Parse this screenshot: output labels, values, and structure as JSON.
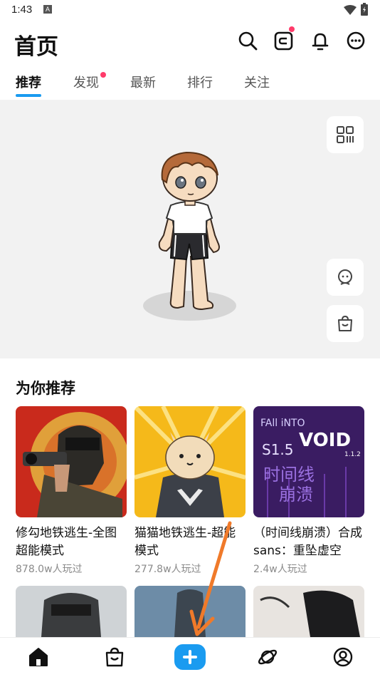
{
  "status_bar": {
    "time": "1:43",
    "notification_badge": "A"
  },
  "header": {
    "title": "首页"
  },
  "tabs": [
    {
      "label": "推荐",
      "active": true
    },
    {
      "label": "发现",
      "active": false,
      "dot": true
    },
    {
      "label": "最新",
      "active": false
    },
    {
      "label": "排行",
      "active": false
    },
    {
      "label": "关注",
      "active": false
    }
  ],
  "recommend": {
    "title": "为你推荐",
    "games": [
      {
        "name": "修勾地铁逃生-全图超能模式",
        "plays": "878.0w人玩过"
      },
      {
        "name": "猫猫地铁逃生-超能模式",
        "plays": "277.8w人玩过"
      },
      {
        "name": "（时间线崩溃）合成sans：重坠虚空",
        "plays": "2.4w人玩过"
      }
    ]
  },
  "thumb_text": {
    "void_top": "FAll iNTO",
    "void_main": "VOID",
    "void_version": "S1.5",
    "void_sub": "1.1.2",
    "void_cn1": "时间线",
    "void_cn2": "崩溃"
  },
  "colors": {
    "accent": "#1a9bf0",
    "badge": "#ff3b6a"
  },
  "icons": [
    "search-icon",
    "wallet-icon",
    "bell-icon",
    "message-icon",
    "qr-code-icon",
    "face-icon",
    "shop-bag-icon",
    "home-icon",
    "store-icon",
    "plus-icon",
    "planet-icon",
    "profile-icon"
  ]
}
